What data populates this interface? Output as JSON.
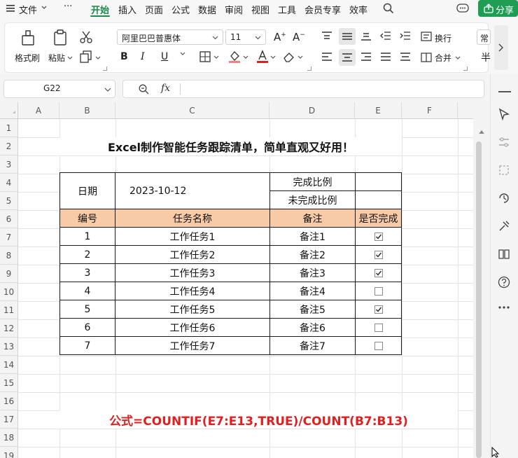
{
  "menubar": {
    "file": "文件",
    "more": "···",
    "tabs": [
      "开始",
      "插入",
      "页面",
      "公式",
      "数据",
      "审阅",
      "视图",
      "工具",
      "会员专享",
      "效率"
    ],
    "active_tab": "开始",
    "share": "分享"
  },
  "ribbon": {
    "format_painter": "格式刷",
    "paste": "粘贴",
    "font_name": "阿里巴巴普惠体",
    "font_size": "11",
    "bold": "B",
    "italic": "I",
    "underline": "U",
    "wrap": "换行",
    "merge": "合并",
    "normal": "常",
    "yen": "半"
  },
  "formula_bar": {
    "cell_ref": "G22",
    "fx": "fx",
    "formula": ""
  },
  "grid": {
    "columns": [
      "A",
      "B",
      "C",
      "D",
      "E",
      "F"
    ],
    "rows": [
      "1",
      "2",
      "3",
      "4",
      "5",
      "6",
      "7",
      "8",
      "9",
      "10",
      "11",
      "12",
      "13",
      "14",
      "15",
      "16",
      "17",
      "18",
      "19"
    ]
  },
  "sheet": {
    "title": "Excel制作智能任务跟踪清单，简单直观又好用！",
    "date_label": "日期",
    "date_value": "2023-10-12",
    "done_ratio_label": "完成比例",
    "undone_ratio_label": "未完成比例",
    "headers": [
      "编号",
      "任务名称",
      "备注",
      "是否完成"
    ],
    "tasks": [
      {
        "id": "1",
        "name": "工作任务1",
        "note": "备注1",
        "done": true
      },
      {
        "id": "2",
        "name": "工作任务2",
        "note": "备注2",
        "done": true
      },
      {
        "id": "3",
        "name": "工作任务3",
        "note": "备注3",
        "done": true
      },
      {
        "id": "4",
        "name": "工作任务4",
        "note": "备注4",
        "done": false
      },
      {
        "id": "5",
        "name": "工作任务5",
        "note": "备注5",
        "done": true
      },
      {
        "id": "6",
        "name": "工作任务6",
        "note": "备注6",
        "done": false
      },
      {
        "id": "7",
        "name": "工作任务7",
        "note": "备注7",
        "done": false
      }
    ],
    "formula_note": "公式=COUNTIF(E7:E13,TRUE)/COUNT(B7:B13)",
    "accent": "#e02020",
    "header_fill": "#f8cba8"
  }
}
